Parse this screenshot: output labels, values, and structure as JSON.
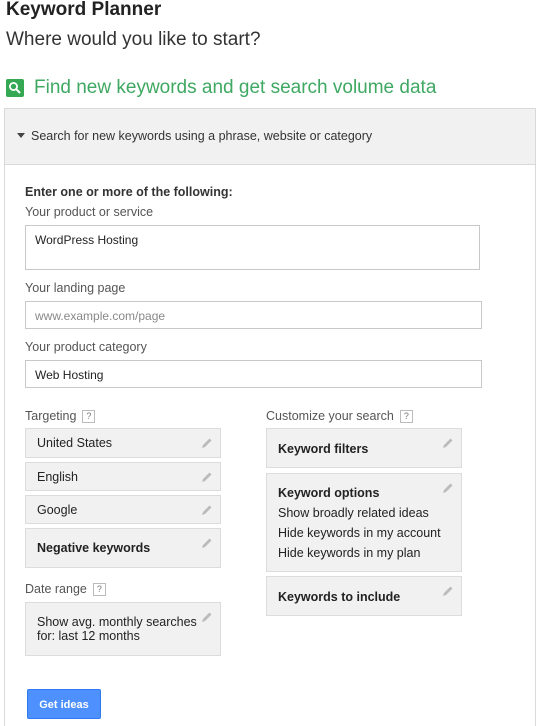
{
  "header": {
    "title": "Keyword Planner",
    "subtitle": "Where would you like to start?",
    "find_title": "Find new keywords and get search volume data"
  },
  "panel": {
    "header": "Search for new keywords using a phrase, website or category",
    "intro": "Enter one or more of the following:",
    "product_label": "Your product or service",
    "product_value": "WordPress Hosting",
    "landing_label": "Your landing page",
    "landing_placeholder": "www.example.com/page",
    "category_label": "Your product category",
    "category_value": "Web Hosting"
  },
  "targeting": {
    "label": "Targeting",
    "items": [
      "United States",
      "English",
      "Google"
    ],
    "negative_keywords": "Negative keywords"
  },
  "date_range": {
    "label": "Date range",
    "value_line1": "Show avg. monthly searches",
    "value_line2": "for: last 12 months"
  },
  "customize": {
    "label": "Customize your search",
    "keyword_filters": "Keyword filters",
    "keyword_options_title": "Keyword options",
    "keyword_options": [
      "Show broadly related ideas",
      "Hide keywords in my account",
      "Hide keywords in my plan"
    ],
    "keywords_to_include": "Keywords to include"
  },
  "actions": {
    "get_ideas": "Get ideas"
  },
  "colors": {
    "accent": "#3fa862",
    "button": "#4d90fe",
    "card": "#f1f1f1"
  },
  "help_glyph": "?"
}
